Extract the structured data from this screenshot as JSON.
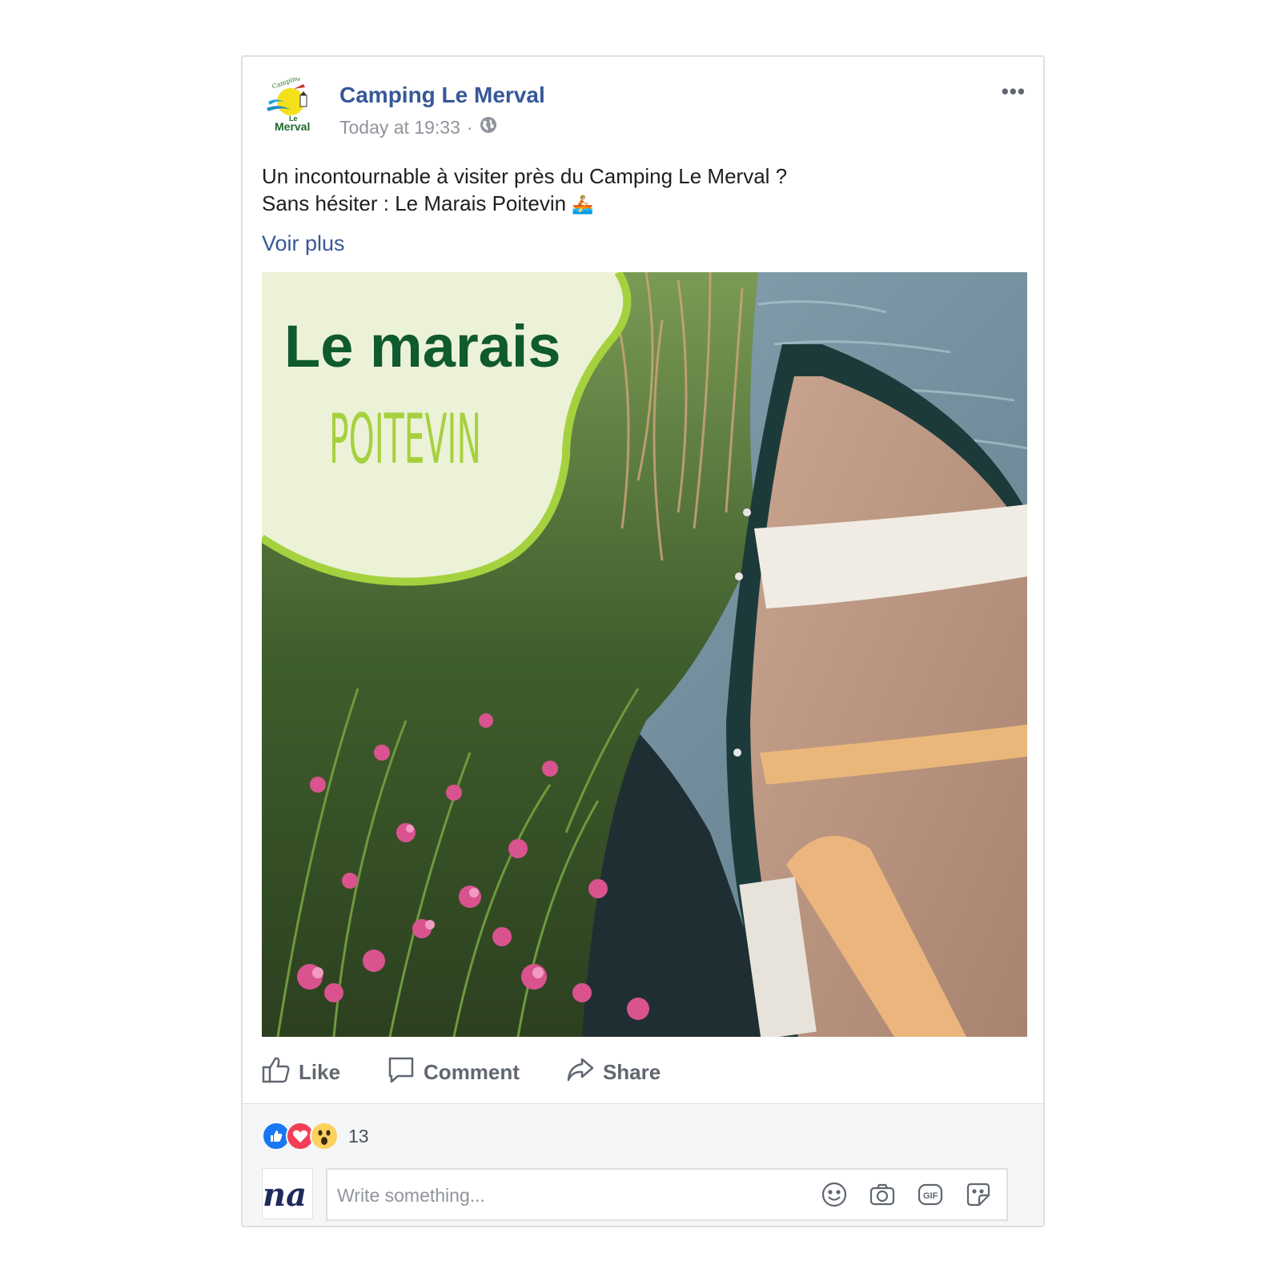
{
  "post": {
    "author": "Camping Le Merval",
    "timestamp": "Today at 19:33",
    "separator": "·",
    "privacy_icon": "globe-icon",
    "more_icon": "more-options-icon",
    "more_label": "•••",
    "text_line1": "Un incontournable à visiter près du Camping Le Merval ?",
    "text_line2": "Sans hésiter : Le Marais Poitevin",
    "text_emoji": "🚣🏼",
    "see_more": "Voir plus"
  },
  "avatar_logo": {
    "arc_text": "Camping",
    "line1": "Le",
    "line2": "Merval"
  },
  "image": {
    "title": "Le marais",
    "subtitle": "POITEVIN"
  },
  "actions": [
    {
      "label": "Like",
      "icon": "thumbs-up-icon"
    },
    {
      "label": "Comment",
      "icon": "comment-icon"
    },
    {
      "label": "Share",
      "icon": "share-icon"
    }
  ],
  "reactions": {
    "icons": [
      "like-reaction-icon",
      "love-reaction-icon",
      "wow-reaction-icon"
    ],
    "count": "13"
  },
  "composer": {
    "placeholder": "Write something...",
    "user_avatar_text": "na",
    "icons": [
      "emoji-icon",
      "camera-icon",
      "gif-icon",
      "sticker-icon"
    ]
  },
  "colors": {
    "link": "#365899",
    "meta": "#90949c",
    "like_blue": "#1877f2",
    "love_red": "#f33e58",
    "wow_yellow": "#fcd15c",
    "title_green": "#0f5a2e",
    "subtitle_green": "#a6d13f"
  }
}
